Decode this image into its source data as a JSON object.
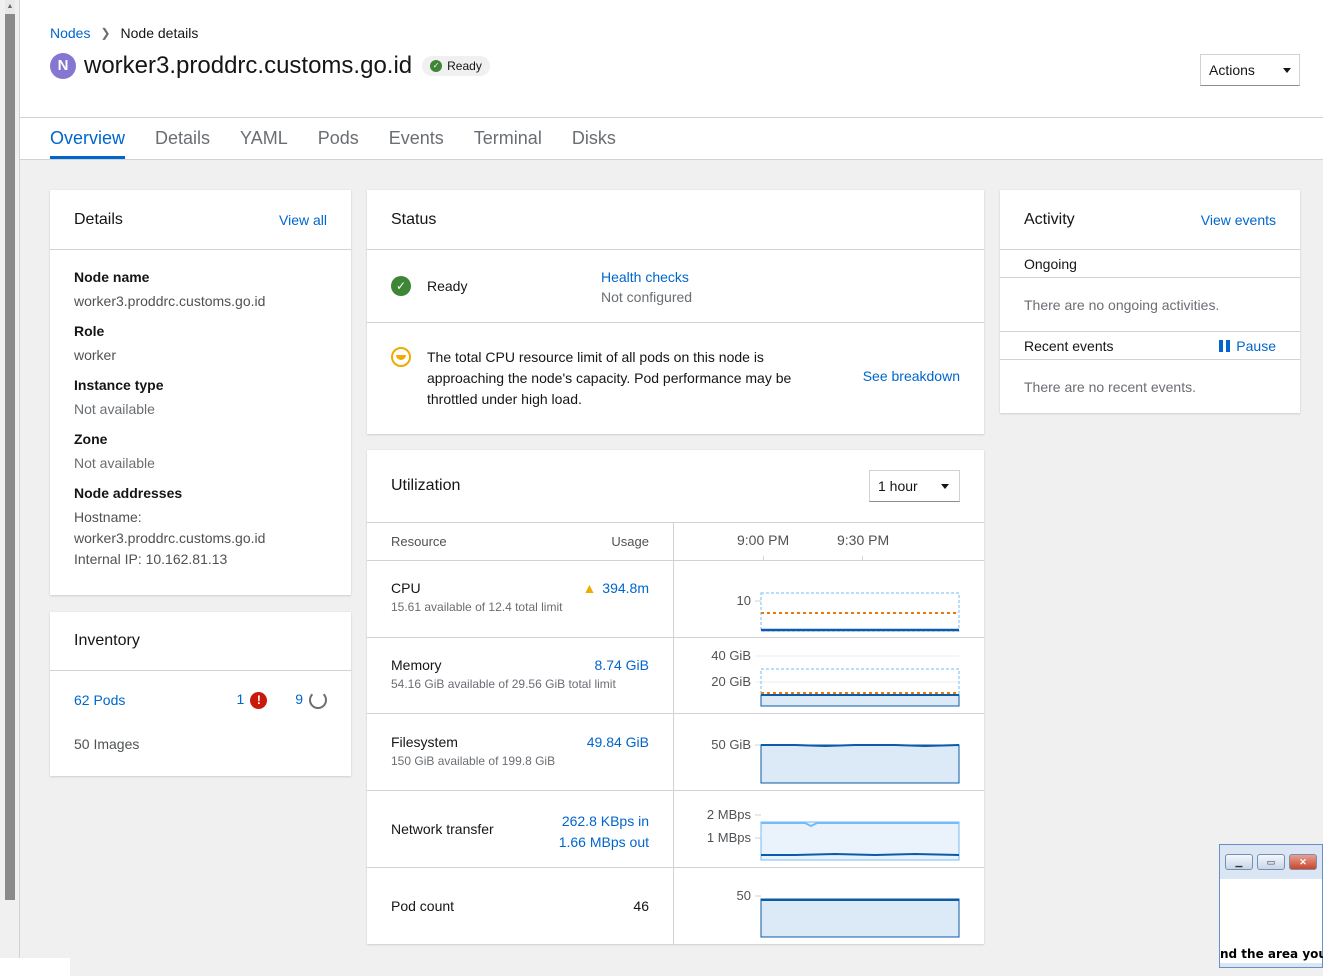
{
  "breadcrumb": {
    "root": "Nodes",
    "current": "Node details"
  },
  "node": {
    "badge": "N",
    "name": "worker3.proddrc.customs.go.id",
    "status": "Ready"
  },
  "actions_label": "Actions",
  "tabs": [
    "Overview",
    "Details",
    "YAML",
    "Pods",
    "Events",
    "Terminal",
    "Disks"
  ],
  "details": {
    "title": "Details",
    "view_all": "View all",
    "fields": [
      {
        "label": "Node name",
        "value": "worker3.proddrc.customs.go.id"
      },
      {
        "label": "Role",
        "value": "worker"
      },
      {
        "label": "Instance type",
        "value": "Not available"
      },
      {
        "label": "Zone",
        "value": "Not available"
      }
    ],
    "addresses_label": "Node addresses",
    "hostname_label": "Hostname:",
    "hostname": "worker3.proddrc.customs.go.id",
    "internal_ip": "Internal IP: 10.162.81.13"
  },
  "inventory": {
    "title": "Inventory",
    "pods": "62 Pods",
    "error_count": "1",
    "pending_count": "9",
    "images": "50 Images"
  },
  "status": {
    "title": "Status",
    "ready": "Ready",
    "health_checks": "Health checks",
    "health_state": "Not configured",
    "warning": "The total CPU resource limit of all pods on this node is approaching the node's capacity. Pod performance may be throttled under high load.",
    "see_breakdown": "See breakdown"
  },
  "utilization": {
    "title": "Utilization",
    "range": "1 hour",
    "col_resource": "Resource",
    "col_usage": "Usage",
    "time_ticks": [
      "9:00 PM",
      "9:30 PM"
    ],
    "rows": [
      {
        "name": "CPU",
        "sub": "15.61 available of 12.4 total limit",
        "value": "394.8m",
        "axis": [
          "10"
        ]
      },
      {
        "name": "Memory",
        "sub": "54.16 GiB available of 29.56 GiB total limit",
        "value": "8.74 GiB",
        "axis": [
          "40 GiB",
          "20 GiB"
        ]
      },
      {
        "name": "Filesystem",
        "sub": "150 GiB available of 199.8 GiB",
        "value": "49.84 GiB",
        "axis": [
          "50 GiB"
        ]
      },
      {
        "name": "Network transfer",
        "sub": "",
        "value_in": "262.8 KBps in",
        "value_out": "1.66 MBps out",
        "axis": [
          "2 MBps",
          "1 MBps"
        ]
      },
      {
        "name": "Pod count",
        "sub": "",
        "value": "46",
        "axis": [
          "50"
        ]
      }
    ]
  },
  "activity": {
    "title": "Activity",
    "view_events": "View events",
    "ongoing": "Ongoing",
    "no_ongoing": "There are no ongoing activities.",
    "recent": "Recent events",
    "pause": "Pause",
    "no_recent": "There are no recent events."
  },
  "popup": {
    "text": "nd the area you"
  },
  "colors": {
    "link": "#0066cc",
    "success": "#3e8635",
    "warning": "#f0ab00",
    "danger": "#c9190b",
    "chart_fill": "#dce9f7",
    "chart_line": "#0b5ba8"
  }
}
